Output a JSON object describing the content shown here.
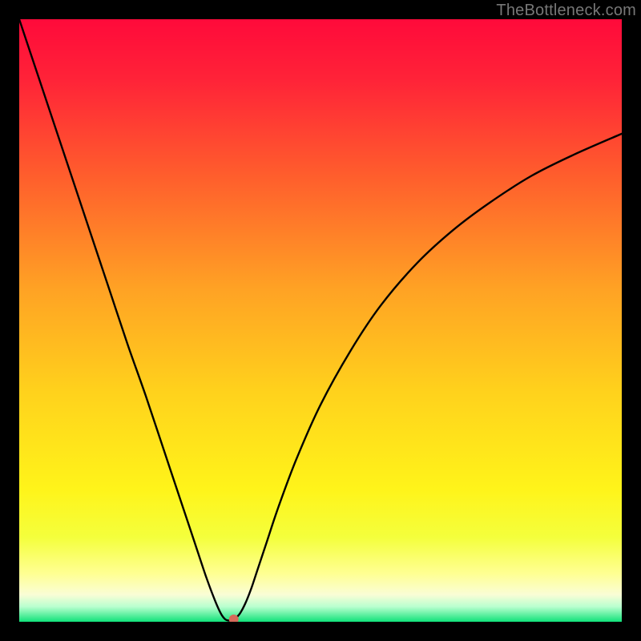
{
  "watermark": "TheBottleneck.com",
  "chart_data": {
    "type": "line",
    "title": "",
    "xlabel": "",
    "ylabel": "",
    "xlim": [
      0,
      100
    ],
    "ylim": [
      0,
      100
    ],
    "background_gradient": {
      "stops": [
        {
          "offset": 0.0,
          "color": "#ff0a3a"
        },
        {
          "offset": 0.1,
          "color": "#ff2338"
        },
        {
          "offset": 0.25,
          "color": "#ff5a2d"
        },
        {
          "offset": 0.45,
          "color": "#ffa324"
        },
        {
          "offset": 0.62,
          "color": "#ffd21c"
        },
        {
          "offset": 0.78,
          "color": "#fff41a"
        },
        {
          "offset": 0.86,
          "color": "#f4ff3c"
        },
        {
          "offset": 0.92,
          "color": "#ffff93"
        },
        {
          "offset": 0.955,
          "color": "#fafdd6"
        },
        {
          "offset": 0.975,
          "color": "#b9ffcf"
        },
        {
          "offset": 1.0,
          "color": "#11e27a"
        }
      ]
    },
    "series": [
      {
        "name": "bottleneck-curve",
        "x": [
          0.0,
          3.0,
          6.0,
          9.0,
          12.0,
          15.0,
          18.0,
          21.0,
          24.0,
          27.0,
          29.0,
          31.0,
          32.5,
          33.5,
          34.2,
          34.8,
          35.3,
          36.5,
          37.5,
          38.5,
          39.5,
          41.0,
          43.0,
          46.0,
          50.0,
          55.0,
          60.0,
          66.0,
          72.0,
          78.0,
          85.0,
          92.0,
          100.0
        ],
        "y": [
          100.0,
          91.0,
          82.0,
          73.0,
          64.0,
          55.0,
          46.0,
          37.5,
          28.5,
          19.5,
          13.5,
          7.5,
          3.5,
          1.3,
          0.4,
          0.2,
          0.2,
          1.2,
          3.0,
          5.5,
          8.5,
          13.0,
          19.0,
          27.0,
          36.0,
          45.0,
          52.5,
          59.5,
          65.0,
          69.5,
          74.0,
          77.5,
          81.0
        ]
      }
    ],
    "marker": {
      "x": 35.6,
      "y": 0.4,
      "color": "#d66a5a",
      "r": 6
    }
  }
}
